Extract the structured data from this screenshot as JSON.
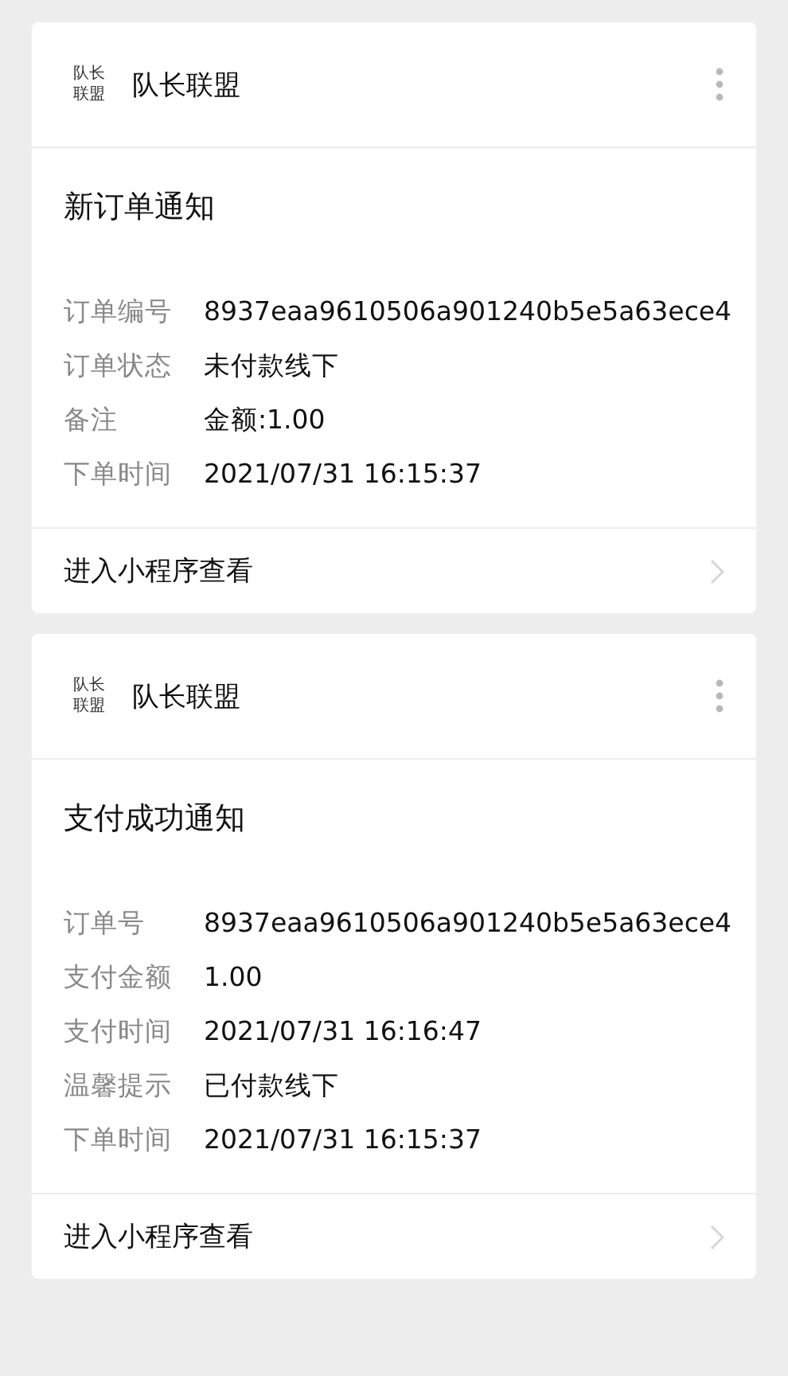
{
  "cards": [
    {
      "logo": "队长联盟",
      "account": "队长联盟",
      "title": "新订单通知",
      "fields": [
        {
          "label": "订单编号",
          "value": "8937eaa9610506a901240b5e5a63ece4"
        },
        {
          "label": "订单状态",
          "value": "未付款线下"
        },
        {
          "label": "备注",
          "value": "金额:1.00"
        },
        {
          "label": "下单时间",
          "value": "2021/07/31 16:15:37"
        }
      ],
      "link": "进入小程序查看"
    },
    {
      "logo": "队长联盟",
      "account": "队长联盟",
      "title": "支付成功通知",
      "fields": [
        {
          "label": "订单号",
          "value": "8937eaa9610506a901240b5e5a63ece4"
        },
        {
          "label": "支付金额",
          "value": "1.00"
        },
        {
          "label": "支付时间",
          "value": "2021/07/31 16:16:47"
        },
        {
          "label": "温馨提示",
          "value": "已付款线下"
        },
        {
          "label": "下单时间",
          "value": "2021/07/31 16:15:37"
        }
      ],
      "link": "进入小程序查看"
    }
  ]
}
